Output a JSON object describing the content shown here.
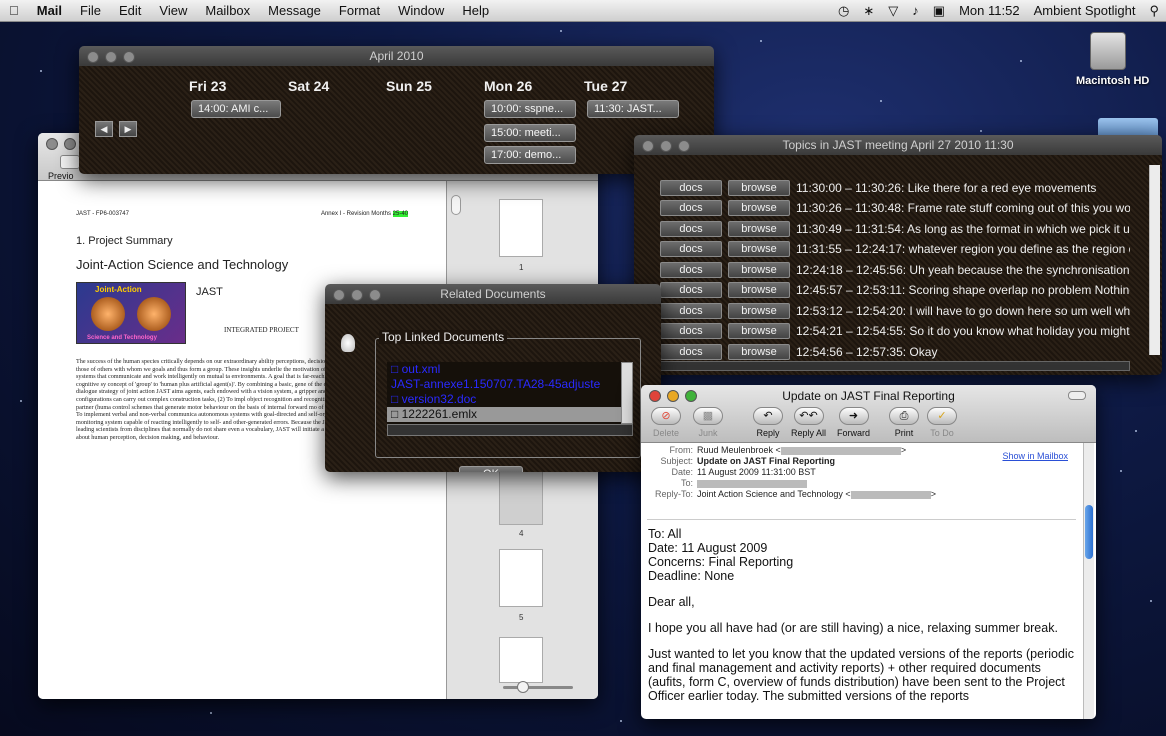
{
  "menubar": {
    "app": "Mail",
    "items": [
      "File",
      "Edit",
      "View",
      "Mailbox",
      "Message",
      "Format",
      "Window",
      "Help"
    ],
    "clock": "Mon 11:52",
    "spotlight": "Ambient Spotlight"
  },
  "desktop": {
    "hd_label": "Macintosh HD"
  },
  "calendar": {
    "title": "April 2010",
    "days": [
      {
        "label": "Fri 23",
        "events": [
          "14:00: AMI c..."
        ]
      },
      {
        "label": "Sat 24",
        "events": []
      },
      {
        "label": "Sun 25",
        "events": []
      },
      {
        "label": "Mon 26",
        "events": [
          "10:00: sspne...",
          "15:00: meeti...",
          "17:00: demo..."
        ]
      },
      {
        "label": "Tue 27",
        "events": [
          "11:30: JAST..."
        ]
      }
    ]
  },
  "pdf": {
    "toolbar_label": "Previo",
    "header_left": "JAST - FP6-003747",
    "header_right": "Annex I - Revision Months",
    "header_badge": "25-40",
    "section": "1. Project Summary",
    "title": "Joint-Action Science and Technology",
    "logo_top": "Joint-Action",
    "logo_bottom": "Science and Technology",
    "jast": "JAST",
    "integrated": "INTEGRATED PROJECT",
    "body": "The success of the human species critically depends on our extraordinary ability perceptions, decisions and behaviour are tuned to those of others with whom we goals and thus form a group. These insights underlie the motivation of the JAST p autonomous systems that communicate and work intelligently on mutual ta environments. A goal that is far-reaching beyond studying individual cognitive sy concept of 'group' to 'human plus artificial agent(s)'. By combining a basic, gene of the cognition, neurobiology and dialogue strategy of joint action JAST aims agents, each endowed with a vision system, a gripper and a speech recognit cooperative configurations can carry out complex construction tasks, (2) To impl object recognition and recognition of gestures and actions of the partner (huma control schemes that generate motor behaviour on the basis of internal forward mo of multiple cognitive systems, (4) To implement verbal and non-verbal communica autonomous systems with goal-directed and self-organizing learning processes, a monitoring system capable of reacting intelligently to self- and other-generated errors. Because the JAST consortium combines leading scientists from disciplines that normally do not share even a vocabulary, JAST will initiate a completely new way of thinking about human perception, decision making, and behaviour.",
    "thumbs": [
      "1",
      "4",
      "5"
    ]
  },
  "topics": {
    "title": "Topics in JAST meeting April 27 2010 11:30",
    "docs_label": "docs",
    "browse_label": "browse",
    "rows": [
      "11:30:00 – 11:30:26: Like there for a red eye movements",
      "11:30:26 – 11:30:48: Frame rate stuff coming out of this you woul",
      "11:30:49 – 11:31:54: As long as the format in which we pick it up",
      "11:31:55 – 12:24:17: whatever region you define as the region of t",
      "12:24:18 – 12:45:56: Uh yeah because the the synchronisation the",
      "12:45:57 – 12:53:11: Scoring shape overlap no problem Nothing is",
      "12:53:12 – 12:54:20: I will have to go down here so um well what v",
      "12:54:21 – 12:54:55: So it do you know what holiday you might wa",
      "12:54:56 – 12:57:35: Okay"
    ]
  },
  "related": {
    "title": "Related Documents",
    "group": "Top Linked Documents",
    "items": [
      "out.xml",
      "JAST-annexe1.150707.TA28-45adjuste",
      "version32.doc",
      "1222261.emlx"
    ],
    "ok": "OK"
  },
  "mail": {
    "title": "Update on JAST Final Reporting",
    "toolbar": [
      "Delete",
      "Junk",
      "Reply",
      "Reply All",
      "Forward",
      "Print",
      "To Do"
    ],
    "headers": [
      {
        "k": "From:",
        "v": "Ruud Meulenbroek <"
      },
      {
        "k": "Subject:",
        "v": "Update on JAST Final Reporting"
      },
      {
        "k": "Date:",
        "v": "11 August 2009 11:31:00 BST"
      },
      {
        "k": "To:",
        "v": ""
      },
      {
        "k": "Reply-To:",
        "v": "Joint Action Science and Technology <"
      }
    ],
    "show_in_mailbox": "Show in Mailbox",
    "body": [
      "To: All",
      "Date: 11 August 2009",
      "Concerns: Final Reporting",
      "Deadline: None",
      "",
      "Dear all,",
      "",
      "I hope you all have had (or are still having) a nice, relaxing summer break.",
      "",
      "Just wanted to let you know that the updated versions of the reports (periodic and final management and activity reports) + other required documents (aufits, form C, overview of funds distribution) have been sent to the Project Officer earlier today. The submitted versions of the reports"
    ]
  }
}
